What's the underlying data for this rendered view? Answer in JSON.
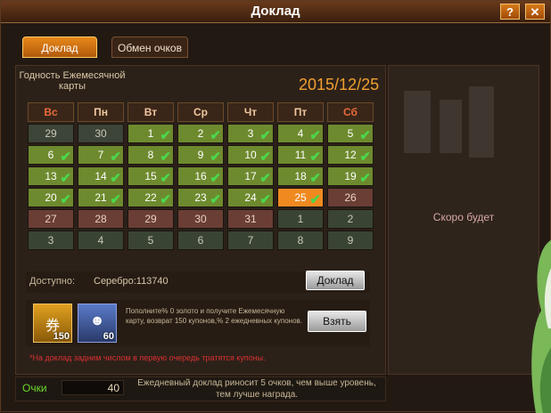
{
  "window": {
    "title": "Доклад",
    "help_label": "?",
    "close_label": "✕"
  },
  "tabs": [
    {
      "label": "Доклад"
    },
    {
      "label": "Обмен очков"
    }
  ],
  "card": {
    "validity": "Годность Ежемесячной карты",
    "date": "2015/12/25"
  },
  "calendar": {
    "weekdays": [
      "Вс",
      "Пн",
      "Вт",
      "Ср",
      "Чт",
      "Пт",
      "Сб"
    ],
    "weeks": [
      [
        {
          "d": "29",
          "s": "prev"
        },
        {
          "d": "30",
          "s": "prev"
        },
        {
          "d": "1",
          "s": "done"
        },
        {
          "d": "2",
          "s": "done"
        },
        {
          "d": "3",
          "s": "done"
        },
        {
          "d": "4",
          "s": "done"
        },
        {
          "d": "5",
          "s": "done"
        }
      ],
      [
        {
          "d": "6",
          "s": "done"
        },
        {
          "d": "7",
          "s": "done"
        },
        {
          "d": "8",
          "s": "done"
        },
        {
          "d": "9",
          "s": "done"
        },
        {
          "d": "10",
          "s": "done"
        },
        {
          "d": "11",
          "s": "done"
        },
        {
          "d": "12",
          "s": "done"
        }
      ],
      [
        {
          "d": "13",
          "s": "done"
        },
        {
          "d": "14",
          "s": "done"
        },
        {
          "d": "15",
          "s": "done"
        },
        {
          "d": "16",
          "s": "done"
        },
        {
          "d": "17",
          "s": "done"
        },
        {
          "d": "18",
          "s": "done"
        },
        {
          "d": "19",
          "s": "done"
        }
      ],
      [
        {
          "d": "20",
          "s": "done"
        },
        {
          "d": "21",
          "s": "done"
        },
        {
          "d": "22",
          "s": "done"
        },
        {
          "d": "23",
          "s": "done"
        },
        {
          "d": "24",
          "s": "done"
        },
        {
          "d": "25",
          "s": "today"
        },
        {
          "d": "26",
          "s": "future"
        }
      ],
      [
        {
          "d": "27",
          "s": "future"
        },
        {
          "d": "28",
          "s": "future"
        },
        {
          "d": "29",
          "s": "future"
        },
        {
          "d": "30",
          "s": "future"
        },
        {
          "d": "31",
          "s": "future"
        },
        {
          "d": "1",
          "s": "next"
        },
        {
          "d": "2",
          "s": "next"
        }
      ],
      [
        {
          "d": "3",
          "s": "next"
        },
        {
          "d": "4",
          "s": "next"
        },
        {
          "d": "5",
          "s": "next"
        },
        {
          "d": "6",
          "s": "next"
        },
        {
          "d": "7",
          "s": "next"
        },
        {
          "d": "8",
          "s": "next"
        },
        {
          "d": "9",
          "s": "next"
        }
      ]
    ]
  },
  "available": {
    "label": "Доступно:",
    "silver": "Серебро:113740",
    "button": "Доклад"
  },
  "promo": {
    "item1_qty": "150",
    "item2_qty": "60",
    "text": "Пополните% 0 золото и получите Ежемесячную карту, возврат 150 купонов,% 2 ежедневных купонов.",
    "button": "Взять"
  },
  "note": "*На доклад задним числом в первую очередь тратятся купоны.",
  "points": {
    "label": "Очки",
    "value": "40",
    "description": "Ежедневный доклад риносит 5 очков, чем выше уровень, тем лучше награда."
  },
  "right_panel": {
    "soon": "Скоро будет"
  }
}
